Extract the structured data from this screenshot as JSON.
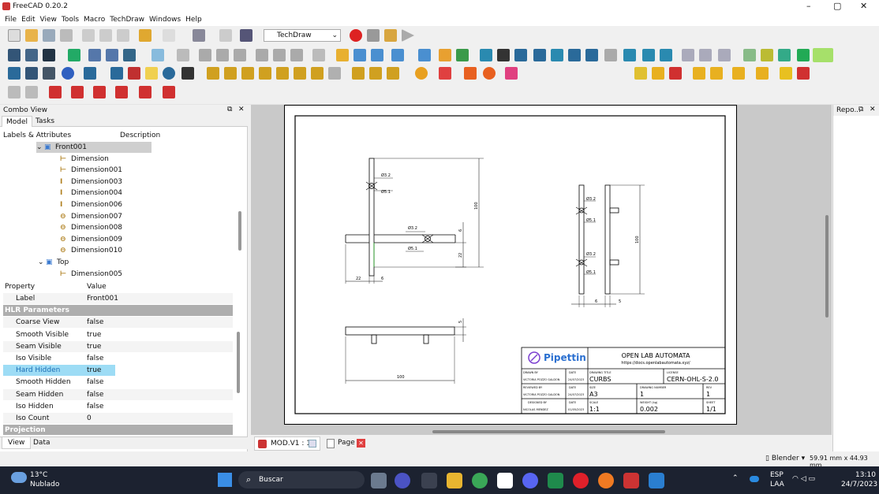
{
  "window": {
    "title": "FreeCAD 0.20.2"
  },
  "menu": [
    "File",
    "Edit",
    "View",
    "Tools",
    "Macro",
    "TechDraw",
    "Windows",
    "Help"
  ],
  "workbench": "TechDraw",
  "combo": {
    "title": "Combo View",
    "tabs": [
      "Model",
      "Tasks"
    ],
    "tree_headers": [
      "Labels & Attributes",
      "Description"
    ],
    "tree": [
      {
        "label": "Front001",
        "icon": "view-icon",
        "level": 1,
        "selected": true
      },
      {
        "label": "Dimension",
        "icon": "dimension-horizontal-icon",
        "level": 2
      },
      {
        "label": "Dimension001",
        "icon": "dimension-horizontal-icon",
        "level": 2
      },
      {
        "label": "Dimension003",
        "icon": "dimension-vertical-icon",
        "level": 2
      },
      {
        "label": "Dimension004",
        "icon": "dimension-vertical-icon",
        "level": 2
      },
      {
        "label": "Dimension006",
        "icon": "dimension-vertical-icon",
        "level": 2
      },
      {
        "label": "Dimension007",
        "icon": "dimension-diameter-icon",
        "level": 2
      },
      {
        "label": "Dimension008",
        "icon": "dimension-diameter-icon",
        "level": 2
      },
      {
        "label": "Dimension009",
        "icon": "dimension-diameter-icon",
        "level": 2
      },
      {
        "label": "Dimension010",
        "icon": "dimension-diameter-icon",
        "level": 2
      },
      {
        "label": "Top",
        "icon": "view-icon",
        "level": 1
      },
      {
        "label": "Dimension005",
        "icon": "dimension-horizontal-icon",
        "level": 2
      }
    ],
    "prop_headers": [
      "Property",
      "Value"
    ],
    "props": [
      {
        "k": "Label",
        "v": "Front001"
      },
      {
        "section": "HLR Parameters"
      },
      {
        "k": "Coarse View",
        "v": "false"
      },
      {
        "k": "Smooth Visible",
        "v": "true"
      },
      {
        "k": "Seam Visible",
        "v": "true"
      },
      {
        "k": "Iso Visible",
        "v": "false"
      },
      {
        "k": "Hard Hidden",
        "v": "true",
        "highlight": true
      },
      {
        "k": "Smooth Hidden",
        "v": "false"
      },
      {
        "k": "Seam Hidden",
        "v": "false"
      },
      {
        "k": "Iso Hidden",
        "v": "false"
      },
      {
        "k": "Iso Count",
        "v": "0"
      },
      {
        "section": "Projection"
      }
    ],
    "bottom_tabs": [
      "View",
      "Data"
    ]
  },
  "drawing": {
    "dims": {
      "d32": "Ø3.2",
      "d51": "Ø5.1",
      "h100": "100",
      "w22": "22",
      "w6": "6",
      "v22": "22",
      "v6": "6",
      "top5": "5",
      "top100": "100",
      "r6": "6",
      "r5": "5",
      "r100": "100"
    },
    "titleblock": {
      "brand": "Pipettin",
      "org": "OPEN LAB AUTOMATA",
      "url": "https://docs.openlabautomata.xyz/",
      "drawn_by_l": "DRAWN BY",
      "drawn_by": "VICTORIA POZZO GALDON",
      "date_l": "DATE",
      "date1": "24/07/2023",
      "title_l": "DRAWING TITLE",
      "title": "CURBS",
      "license_l": "LICENSE",
      "license": "CERN-OHL-S-2.0",
      "reviewed_l": "REVIEWED BY",
      "reviewed": "VICTORIA POZZO GALDON",
      "date2": "24/07/2023",
      "size_l": "SIZE",
      "size": "A3",
      "dwgno_l": "DRAWING NUMBER",
      "dwgno": "1",
      "rev_l": "REV",
      "rev": "1",
      "designed_l": "DESIGNED BY",
      "designed": "NICOLAS MENDEZ",
      "date3": "01/05/2023",
      "scale_l": "SCALE",
      "scale": "1:1",
      "weight_l": "WEIGHT (kg)",
      "weight": "0.002",
      "sheet_l": "SHEET",
      "sheet": "1/1"
    }
  },
  "doc_tabs": [
    "MOD.V1 : 1*",
    "Page"
  ],
  "report": {
    "title": "Repo..."
  },
  "status": {
    "nav": "Blender",
    "dims": "59.91 mm x 44.93 mm"
  },
  "taskbar": {
    "temp": "13°C",
    "weather": "Nublado",
    "search": "Buscar",
    "lang1": "ESP",
    "lang2": "LAA",
    "time": "13:10",
    "date": "24/7/2023"
  }
}
